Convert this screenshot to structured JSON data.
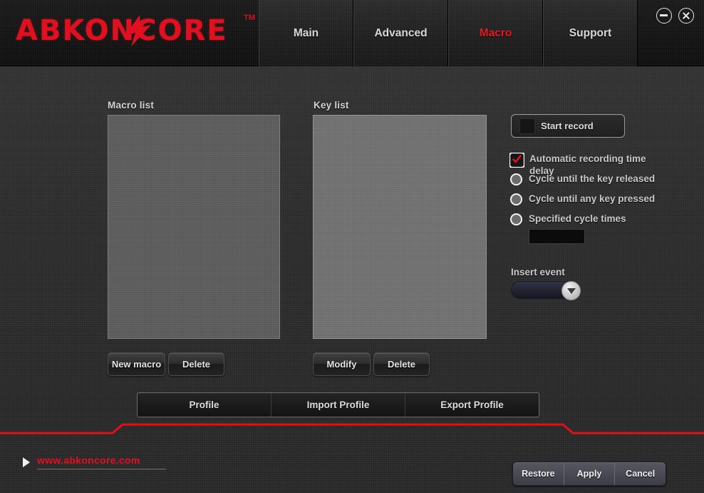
{
  "window": {
    "brand": "ABKONCORE",
    "brand_tm": "TM",
    "minimize_icon": "minimize-icon",
    "close_icon": "close-icon"
  },
  "tabs": [
    {
      "label": "Main",
      "active": false
    },
    {
      "label": "Advanced",
      "active": false
    },
    {
      "label": "Macro",
      "active": true
    },
    {
      "label": "Support",
      "active": false
    }
  ],
  "panels": {
    "macro_list_label": "Macro list",
    "key_list_label": "Key list",
    "macro_list_items": [],
    "key_list_items": []
  },
  "macro_buttons": {
    "new_macro": "New macro",
    "delete": "Delete"
  },
  "key_buttons": {
    "modify": "Modify",
    "delete": "Delete"
  },
  "record": {
    "start_record_label": "Start record",
    "record_icon": "record-square-icon",
    "options": [
      {
        "type": "checkbox",
        "label": "Automatic recording time delay",
        "checked": true
      },
      {
        "type": "radio",
        "label": "Cycle until the key released",
        "checked": false
      },
      {
        "type": "radio",
        "label": "Cycle until any key pressed",
        "checked": false
      },
      {
        "type": "radio",
        "label": "Specified cycle times",
        "checked": false
      }
    ],
    "cycle_times_value": "",
    "cycle_times_placeholder": ""
  },
  "insert_event": {
    "label": "Insert event",
    "selected": "",
    "dropdown_icon": "chevron-down-icon"
  },
  "profile_bar": [
    {
      "label": "Profile"
    },
    {
      "label": "Import Profile"
    },
    {
      "label": "Export Profile"
    }
  ],
  "footer": {
    "link_icon": "chevron-right-icon",
    "url": "www.abkoncore.com",
    "actions": [
      {
        "label": "Restore"
      },
      {
        "label": "Apply"
      },
      {
        "label": "Cancel"
      }
    ]
  },
  "colors": {
    "brand_red": "#e01020",
    "active_tab": "#e21a22",
    "divider_red": "#e21018",
    "panel_bg": "#2b2b2b",
    "header_bg": "#141414"
  }
}
